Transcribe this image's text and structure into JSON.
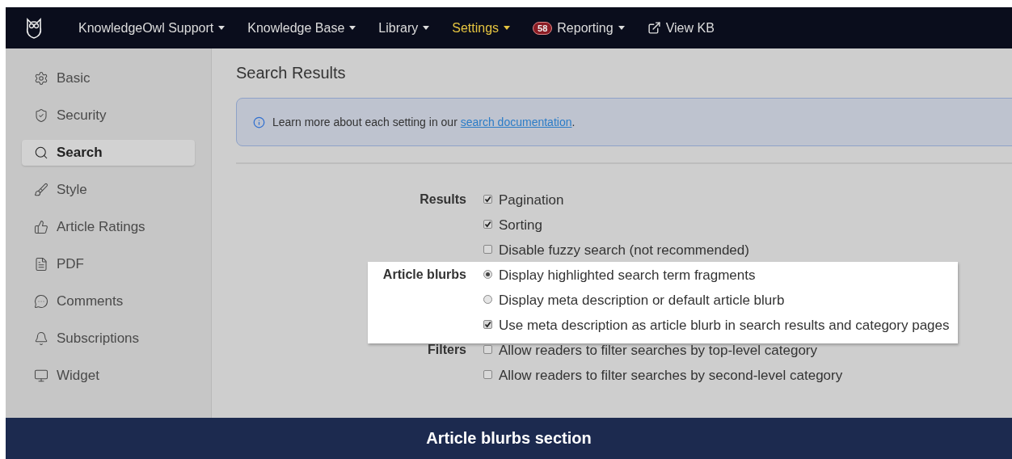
{
  "navbar": {
    "items": [
      {
        "label": "KnowledgeOwl Support",
        "selected": false,
        "kind": "menu"
      },
      {
        "label": "Knowledge Base",
        "selected": false,
        "kind": "menu"
      },
      {
        "label": "Library",
        "selected": false,
        "kind": "menu"
      },
      {
        "label": "Settings",
        "selected": true,
        "kind": "menu"
      },
      {
        "label": "Reporting",
        "selected": false,
        "kind": "menu",
        "badge": "58"
      },
      {
        "label": "View KB",
        "selected": false,
        "kind": "external"
      }
    ]
  },
  "sidebar": {
    "items": [
      {
        "label": "Basic",
        "selected": false
      },
      {
        "label": "Security",
        "selected": false
      },
      {
        "label": "Search",
        "selected": true
      },
      {
        "label": "Style",
        "selected": false
      },
      {
        "label": "Article Ratings",
        "selected": false
      },
      {
        "label": "PDF",
        "selected": false
      },
      {
        "label": "Comments",
        "selected": false
      },
      {
        "label": "Subscriptions",
        "selected": false
      },
      {
        "label": "Widget",
        "selected": false
      }
    ]
  },
  "page": {
    "title": "Search Results",
    "info": {
      "text": "Learn more about each setting in our",
      "link": "search documentation",
      "after": "."
    },
    "sections": [
      {
        "label": "Results",
        "highlighted": false,
        "options": [
          {
            "kind": "checkbox",
            "label": "Pagination",
            "checked": true
          },
          {
            "kind": "checkbox",
            "label": "Sorting",
            "checked": true
          },
          {
            "kind": "checkbox",
            "label": "Disable fuzzy search (not recommended)",
            "checked": false
          }
        ]
      },
      {
        "label": "Article blurbs",
        "highlighted": true,
        "options": [
          {
            "kind": "radio",
            "label": "Display highlighted search term fragments",
            "checked": true
          },
          {
            "kind": "radio",
            "label": "Display meta description or default article blurb",
            "checked": false
          },
          {
            "kind": "checkbox",
            "label": "Use meta description as article blurb in search results and category pages",
            "checked": true
          }
        ]
      },
      {
        "label": "Filters",
        "highlighted": false,
        "options": [
          {
            "kind": "checkbox",
            "label": "Allow readers to filter searches by top-level category",
            "checked": false
          },
          {
            "kind": "checkbox",
            "label": "Allow readers to filter searches by second-level category",
            "checked": false
          }
        ]
      }
    ]
  },
  "caption": "Article blurbs section"
}
